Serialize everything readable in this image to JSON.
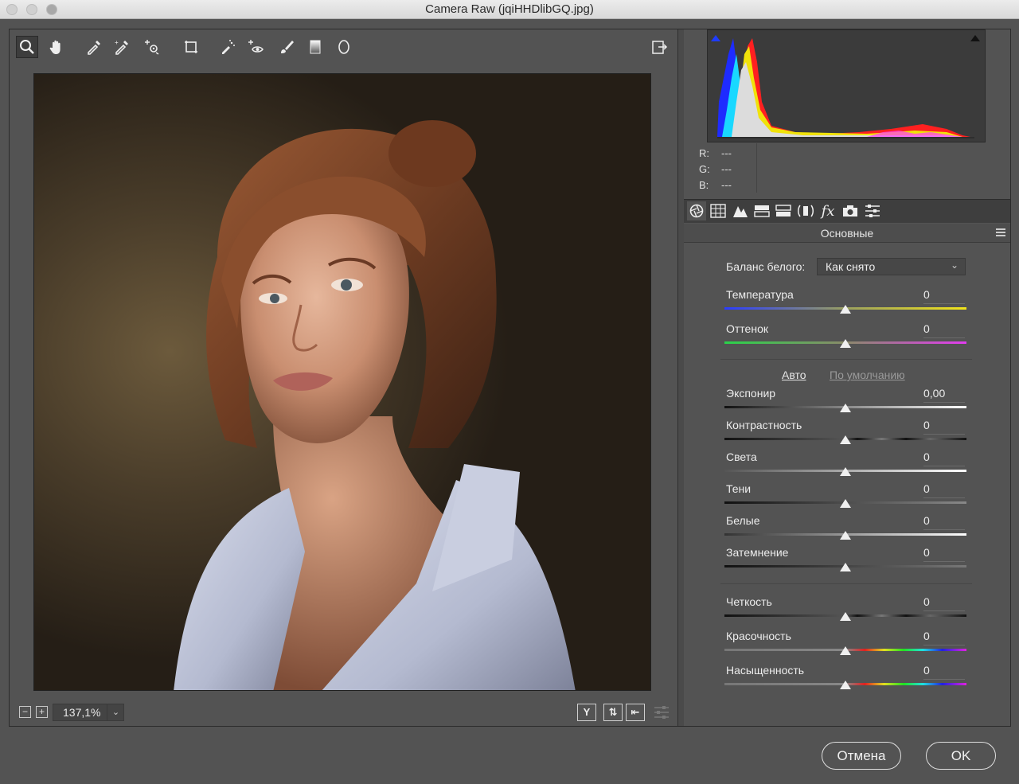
{
  "window": {
    "title": "Camera Raw (jqiHHDlibGQ.jpg)"
  },
  "toolbar": {
    "tools": [
      "zoom-icon",
      "hand-icon",
      "white-balance-icon",
      "color-sampler-icon",
      "targeted-adjustment-icon",
      "transform-icon",
      "spot-removal-icon",
      "red-eye-icon",
      "adjustment-brush-icon",
      "graduated-filter-icon",
      "radial-filter-icon"
    ],
    "open_preferences": "open-image-icon"
  },
  "bottom": {
    "zoom": "137,1%",
    "view_y": "Y"
  },
  "histogram": {
    "r_label": "R:",
    "g_label": "G:",
    "b_label": "B:",
    "r_value": "---",
    "g_value": "---",
    "b_value": "---"
  },
  "panel_tabs": {
    "fx_label": "fx"
  },
  "panel": {
    "title": "Основные",
    "white_balance": {
      "label": "Баланс белого:",
      "value": "Как снято"
    },
    "auto": "Авто",
    "defaults": "По умолчанию",
    "sliders": [
      {
        "label": "Температура",
        "value": "0"
      },
      {
        "label": "Оттенок",
        "value": "0"
      },
      {
        "label": "Экспонир",
        "value": "0,00"
      },
      {
        "label": "Контрастность",
        "value": "0"
      },
      {
        "label": "Света",
        "value": "0"
      },
      {
        "label": "Тени",
        "value": "0"
      },
      {
        "label": "Белые",
        "value": "0"
      },
      {
        "label": "Затемнение",
        "value": "0"
      },
      {
        "label": "Четкость",
        "value": "0"
      },
      {
        "label": "Красочность",
        "value": "0"
      },
      {
        "label": "Насыщенность",
        "value": "0"
      }
    ]
  },
  "buttons": {
    "cancel": "Отмена",
    "ok": "OK"
  },
  "colors": {
    "panel_bg": "#535353",
    "dark_bg": "#3e3e3e",
    "link_active": "#e6e6e6",
    "link_inactive": "#9a9a9a"
  }
}
